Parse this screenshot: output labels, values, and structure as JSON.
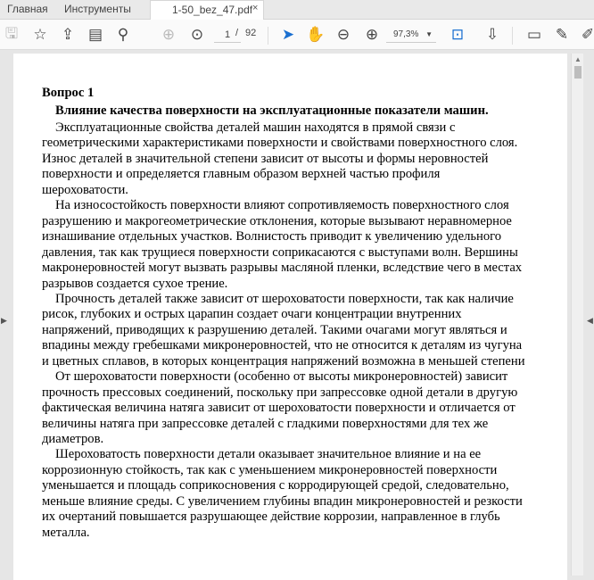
{
  "tabs": {
    "home": "Главная",
    "tools": "Инструменты",
    "document": "1-50_bez_47.pdf",
    "close": "×"
  },
  "toolbar": {
    "page_current": "1",
    "page_sep": "/",
    "page_total": "92",
    "zoom": "97,3%"
  },
  "doc": {
    "heading": "Вопрос 1",
    "title": "Влияние качества поверхности на эксплуатационные показатели машин.",
    "lines": [
      {
        "t": "Эксплуатационные свойства деталей машин находятся в прямой связи с",
        "i": true
      },
      {
        "t": "геометрическими характеристиками поверхности и свойствами поверхностного слоя.",
        "i": false
      },
      {
        "t": "Износ деталей в значительной степени зависит от высоты и формы неровностей",
        "i": false
      },
      {
        "t": "поверхности и определяется главным образом верхней частью профиля",
        "i": false
      },
      {
        "t": "шероховатости.",
        "i": false
      },
      {
        "t": "На износостойкость поверхности влияют сопротивляемость поверхностного слоя",
        "i": true
      },
      {
        "t": "разрушению и макрогеометрические отклонения, которые вызывают неравномерное",
        "i": false
      },
      {
        "t": "изнашивание отдельных участков. Волнистость приводит к увеличению удельного",
        "i": false
      },
      {
        "t": "давления, так как трущиеся поверхности соприкасаются с выступами волн. Вершины",
        "i": false
      },
      {
        "t": "макронеровностей могут вызвать разрывы масляной пленки, вследствие чего в местах",
        "i": false
      },
      {
        "t": "разрывов создается сухое трение.",
        "i": false
      },
      {
        "t": "Прочность деталей также зависит от шероховатости поверхности, так как наличие",
        "i": true
      },
      {
        "t": "рисок, глубоких и острых царапин создает очаги концентрации внутренних",
        "i": false
      },
      {
        "t": "напряжений, приводящих к разрушению деталей. Такими очагами могут являться и",
        "i": false
      },
      {
        "t": "впадины между гребешками микронеровностей, что не относится к деталям из чугуна",
        "i": false
      },
      {
        "t": "и цветных сплавов, в которых концентрация напряжений возможна в меньшей степени",
        "i": false
      },
      {
        "t": "От шероховатости поверхности (особенно от высоты микронеровностей) зависит",
        "i": true
      },
      {
        "t": "прочность прессовых соединений, поскольку при запрессовке одной детали в другую",
        "i": false
      },
      {
        "t": "фактическая величина натяга зависит от шероховатости поверхности и отличается от",
        "i": false
      },
      {
        "t": "величины натяга при запрессовке деталей с гладкими поверхностями для тех же",
        "i": false
      },
      {
        "t": "диаметров.",
        "i": false
      },
      {
        "t": "Шероховатость поверхности детали оказывает значительное влияние и на ее",
        "i": true
      },
      {
        "t": "коррозионную стойкость, так как с уменьшением микронеровностей поверхности",
        "i": false
      },
      {
        "t": "уменьшается и площадь соприкосновения с корродирующей средой, следовательно,",
        "i": false
      },
      {
        "t": "меньше влияние среды. С увеличением глубины впадин микронеровностей и резкости",
        "i": false
      },
      {
        "t": "их очертаний повышается разрушающее действие коррозии, направленное в глубь",
        "i": false
      },
      {
        "t": "металла.",
        "i": false
      }
    ]
  }
}
